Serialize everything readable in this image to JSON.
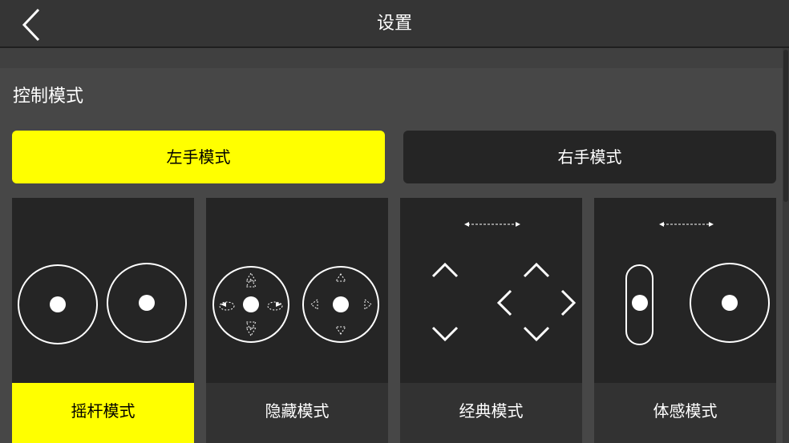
{
  "header": {
    "title": "设置",
    "back_icon": "chevron-left-icon"
  },
  "section": {
    "title": "控制模式"
  },
  "hand_modes": [
    {
      "label": "左手模式",
      "selected": true
    },
    {
      "label": "右手模式",
      "selected": false
    }
  ],
  "control_modes": [
    {
      "label": "摇杆模式",
      "icon": "dual-joystick-icon",
      "selected": true
    },
    {
      "label": "隐藏模式",
      "icon": "hidden-joystick-icon",
      "selected": false
    },
    {
      "label": "经典模式",
      "icon": "classic-dpad-icon",
      "selected": false
    },
    {
      "label": "体感模式",
      "icon": "motion-sensing-icon",
      "selected": false
    }
  ],
  "colors": {
    "accent": "#ffff00",
    "background": "#474747",
    "header": "#353535",
    "card": "#252525",
    "card_label": "#323232"
  }
}
